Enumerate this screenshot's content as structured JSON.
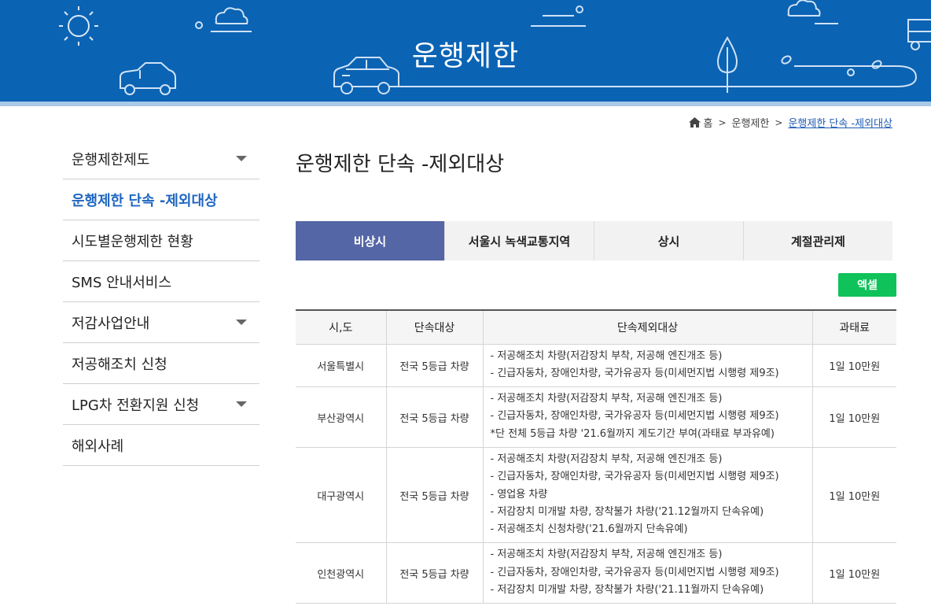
{
  "banner": {
    "title": "운행제한"
  },
  "breadcrumb": {
    "home": "홈",
    "level1": "운행제한",
    "current": "운행제한 단속 -제외대상"
  },
  "sidebar": {
    "items": [
      {
        "label": "운행제한제도",
        "has_caret": true,
        "active": false
      },
      {
        "label": "운행제한 단속 -제외대상",
        "has_caret": false,
        "active": true
      },
      {
        "label": "시도별운행제한 현황",
        "has_caret": false,
        "active": false
      },
      {
        "label": "SMS 안내서비스",
        "has_caret": false,
        "active": false
      },
      {
        "label": "저감사업안내",
        "has_caret": true,
        "active": false
      },
      {
        "label": "저공해조치 신청",
        "has_caret": false,
        "active": false
      },
      {
        "label": "LPG차 전환지원 신청",
        "has_caret": true,
        "active": false
      },
      {
        "label": "해외사례",
        "has_caret": false,
        "active": false
      }
    ]
  },
  "main": {
    "title": "운행제한 단속 -제외대상",
    "tabs": [
      {
        "label": "비상시",
        "active": true
      },
      {
        "label": "서울시 녹색교통지역",
        "active": false
      },
      {
        "label": "상시",
        "active": false
      },
      {
        "label": "계절관리제",
        "active": false
      }
    ],
    "excel_label": "엑셀",
    "table": {
      "headers": [
        "시,도",
        "단속대상",
        "단속제외대상",
        "과태료"
      ],
      "rows": [
        {
          "region": "서울특별시",
          "target": "전국 5등급 차량",
          "exclusions": [
            "- 저공해조치 차량(저감장치 부착, 저공해 엔진개조 등)",
            "- 긴급자동차, 장애인차량, 국가유공자 등(미세먼지법 시행령 제9조)"
          ],
          "fine": "1일 10만원"
        },
        {
          "region": "부산광역시",
          "target": "전국 5등급 차량",
          "exclusions": [
            "- 저공해조치 차량(저감장치 부착, 저공해 엔진개조 등)",
            "- 긴급자동차, 장애인차량, 국가유공자 등(미세먼지법 시행령 제9조)",
            "*단 전체 5등급 차량 '21.6월까지 계도기간 부여(과태료 부과유예)"
          ],
          "fine": "1일 10만원"
        },
        {
          "region": "대구광역시",
          "target": "전국 5등급 차량",
          "exclusions": [
            "- 저공해조치 차량(저감장치 부착, 저공해 엔진개조 등)",
            "- 긴급자동차, 장애인차량, 국가유공자 등(미세먼지법 시행령 제9조)",
            "- 영업용 차량",
            "- 저감장치 미개발 차량, 장착불가 차량('21.12월까지 단속유예)",
            "- 저공해조치 신청차량('21.6월까지 단속유예)"
          ],
          "fine": "1일 10만원"
        },
        {
          "region": "인천광역시",
          "target": "전국 5등급 차량",
          "exclusions": [
            "- 저공해조치 차량(저감장치 부착, 저공해 엔진개조 등)",
            "- 긴급자동차, 장애인차량, 국가유공자 등(미세먼지법 시행령 제9조)",
            "- 저감장치 미개발 차량, 장착불가 차량('21.11월까지 단속유예)"
          ],
          "fine": "1일 10만원"
        }
      ]
    }
  },
  "colors": {
    "banner_blue": "#0b63b4",
    "active_tab": "#5566a6",
    "active_side": "#1f66c1",
    "excel_green": "#10c25a"
  }
}
